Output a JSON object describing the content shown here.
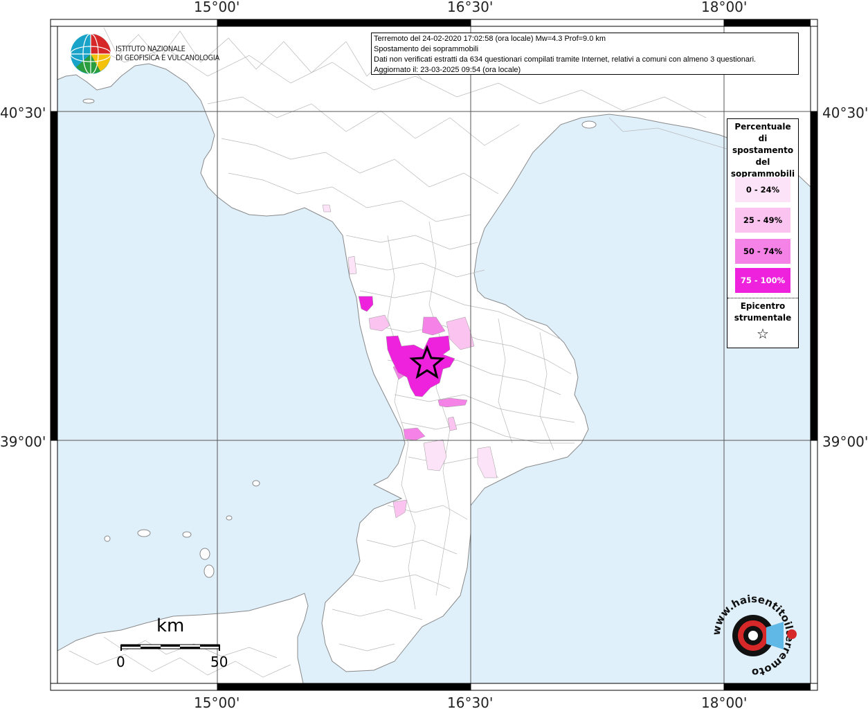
{
  "info": {
    "line1": "Terremoto del 24-02-2020 17:02:58 (ora locale) Mw=4.3 Prof=9.0 km",
    "line2": "Spostamento dei soprammobili",
    "line3": "Dati non verificati estratti da 634 questionari compilati tramite Internet, relativi a comuni con almeno 3 questionari.",
    "line4": "Aggiornato il: 23-03-2025 09:54 (ora locale)"
  },
  "axes": {
    "top": [
      "15°00'",
      "16°30'",
      "18°00'"
    ],
    "bottom": [
      "15°00'",
      "16°30'",
      "18°00'"
    ],
    "left": [
      "40°30'",
      "39°00'"
    ],
    "right": [
      "40°30'",
      "39°00'"
    ]
  },
  "legend": {
    "title": [
      "Percentuale",
      "di",
      "spostamento",
      "del",
      "soprammobili"
    ],
    "items": [
      {
        "label": "0 - 24%",
        "color": "#fde3f7",
        "text_color": "#000000"
      },
      {
        "label": "25 - 49%",
        "color": "#fbc3f0",
        "text_color": "#000000"
      },
      {
        "label": "50 - 74%",
        "color": "#f582e6",
        "text_color": "#000000"
      },
      {
        "label": "75 - 100%",
        "color": "#ee22dd",
        "text_color": "#ffffff"
      }
    ],
    "epicenter_title": [
      "Epicentro",
      "strumentale"
    ],
    "epicenter_symbol": "☆"
  },
  "scale": {
    "unit": "km",
    "min": "0",
    "max": "50"
  },
  "logos": {
    "ingv": [
      "ISTITUTO NAZIONALE",
      "DI GEOFISICA E VULCANOLOGIA"
    ],
    "hsit": "www.haisentitoilterremoto.it"
  },
  "colors": {
    "sea": "#dff0fb",
    "land": "#ffffff",
    "border": "#999999"
  }
}
